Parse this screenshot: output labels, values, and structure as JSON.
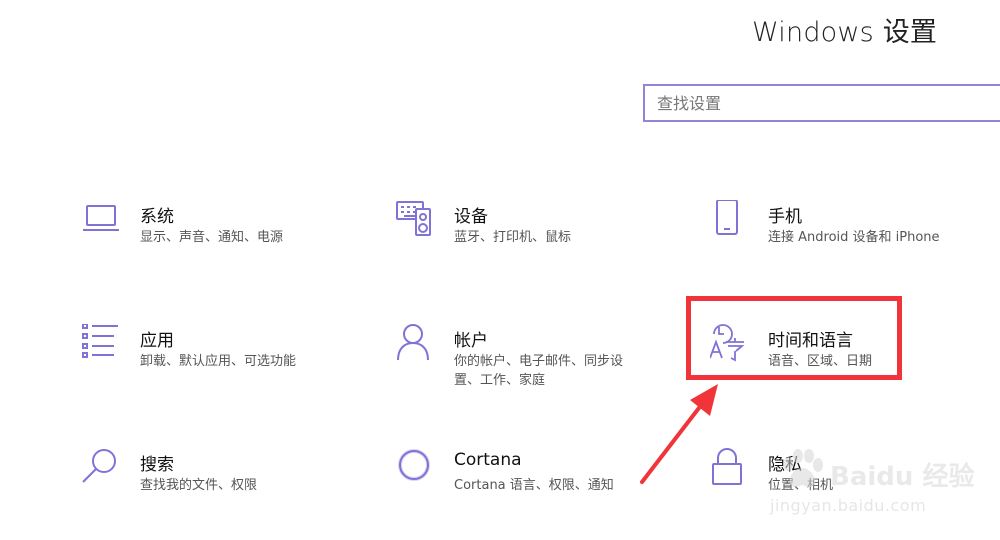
{
  "window_title": "Windows 设置",
  "search": {
    "placeholder": "查找设置"
  },
  "tiles": [
    {
      "icon": "laptop-icon",
      "name": "系统",
      "desc": "显示、声音、通知、电源"
    },
    {
      "icon": "keyboard-speaker-icon",
      "name": "设备",
      "desc": "蓝牙、打印机、鼠标"
    },
    {
      "icon": "phone-icon",
      "name": "手机",
      "desc": "连接 Android 设备和 iPhone"
    },
    {
      "icon": "apps-list-icon",
      "name": "应用",
      "desc": "卸载、默认应用、可选功能"
    },
    {
      "icon": "person-icon",
      "name": "帐户",
      "desc": "你的帐户、电子邮件、同步设置、工作、家庭"
    },
    {
      "icon": "time-language-icon",
      "name": "时间和语言",
      "desc": "语音、区域、日期"
    },
    {
      "icon": "search-icon",
      "name": "搜索",
      "desc": "查找我的文件、权限"
    },
    {
      "icon": "cortana-icon",
      "name": "Cortana",
      "desc": "Cortana 语言、权限、通知"
    },
    {
      "icon": "lock-icon",
      "name": "隐私",
      "desc": "位置、相机"
    }
  ],
  "watermark": {
    "text": "Baidu 经验",
    "url": "jingyan.baidu.com"
  },
  "colors": {
    "accent": "#7f74d6",
    "highlight": "#f1343a",
    "search_border": "#8f86d9"
  }
}
